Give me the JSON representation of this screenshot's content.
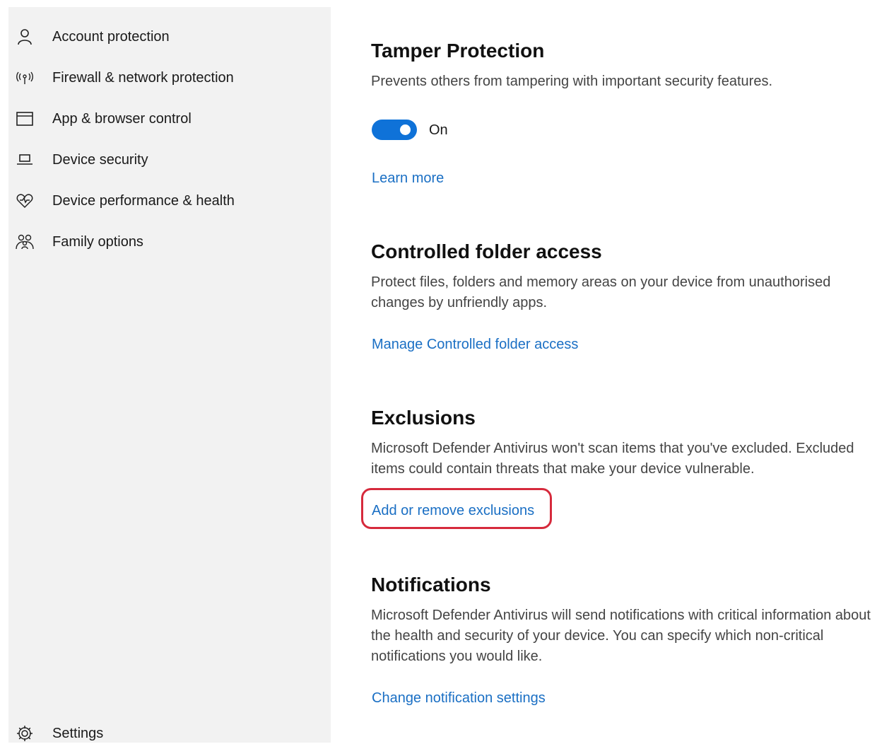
{
  "sidebar": {
    "items": [
      {
        "label": "Account protection",
        "icon": "person-icon"
      },
      {
        "label": "Firewall & network protection",
        "icon": "antenna-icon"
      },
      {
        "label": "App & browser control",
        "icon": "browser-window-icon"
      },
      {
        "label": "Device security",
        "icon": "laptop-icon"
      },
      {
        "label": "Device performance & health",
        "icon": "heart-pulse-icon"
      },
      {
        "label": "Family options",
        "icon": "family-icon"
      }
    ],
    "settings": {
      "label": "Settings",
      "icon": "gear-icon"
    }
  },
  "tamper": {
    "title": "Tamper Protection",
    "description": "Prevents others from tampering with important security features.",
    "toggle_label": "On",
    "toggle_on": true,
    "link": "Learn more"
  },
  "controlled_folder": {
    "title": "Controlled folder access",
    "description": "Protect files, folders and memory areas on your device from unauthorised changes by unfriendly apps.",
    "link": "Manage Controlled folder access"
  },
  "exclusions": {
    "title": "Exclusions",
    "description": "Microsoft Defender Antivirus won't scan items that you've excluded. Excluded items could contain threats that make your device vulnerable.",
    "link": "Add or remove exclusions"
  },
  "notifications": {
    "title": "Notifications",
    "description": "Microsoft Defender Antivirus will send notifications with critical information about the health and security of your device. You can specify which non-critical notifications you would like.",
    "link": "Change notification settings"
  },
  "colors": {
    "accent": "#0f72d8",
    "link": "#1a6fc4",
    "highlight": "#d62a3c",
    "sidebar_bg": "#f2f2f2"
  }
}
